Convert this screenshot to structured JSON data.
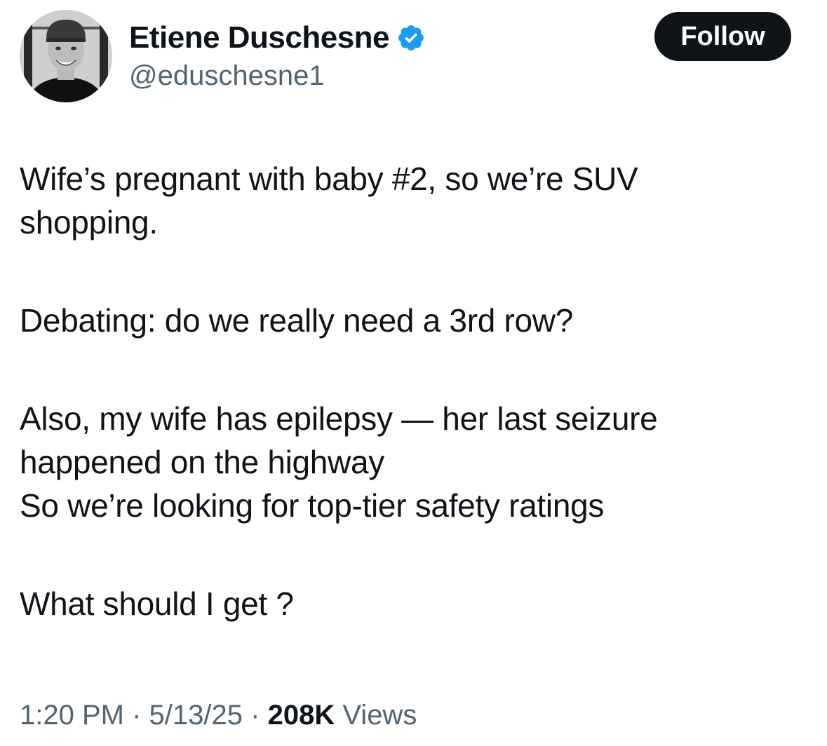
{
  "author": {
    "display_name": "Etiene Duschesne",
    "handle": "@eduschesne1",
    "verified": true,
    "verified_icon": "verified-badge-icon",
    "avatar_icon": "profile-photo"
  },
  "follow_button": {
    "label": "Follow"
  },
  "tweet": {
    "lines": [
      "Wife’s pregnant with baby #2, so we’re SUV",
      "shopping.",
      "Debating: do we really need a 3rd row?",
      "Also, my wife has epilepsy — her last seizure",
      "happened on the highway",
      "So we’re looking for top-tier safety ratings",
      "What should I get ?"
    ]
  },
  "meta": {
    "time": "1:20 PM",
    "separator": "·",
    "date": "5/13/25",
    "views_count": "208K",
    "views_label": "Views"
  },
  "colors": {
    "text_primary": "#0f1419",
    "text_secondary": "#536471",
    "verified_blue": "#1d9bf0",
    "button_bg": "#0f1419",
    "button_text": "#ffffff"
  }
}
